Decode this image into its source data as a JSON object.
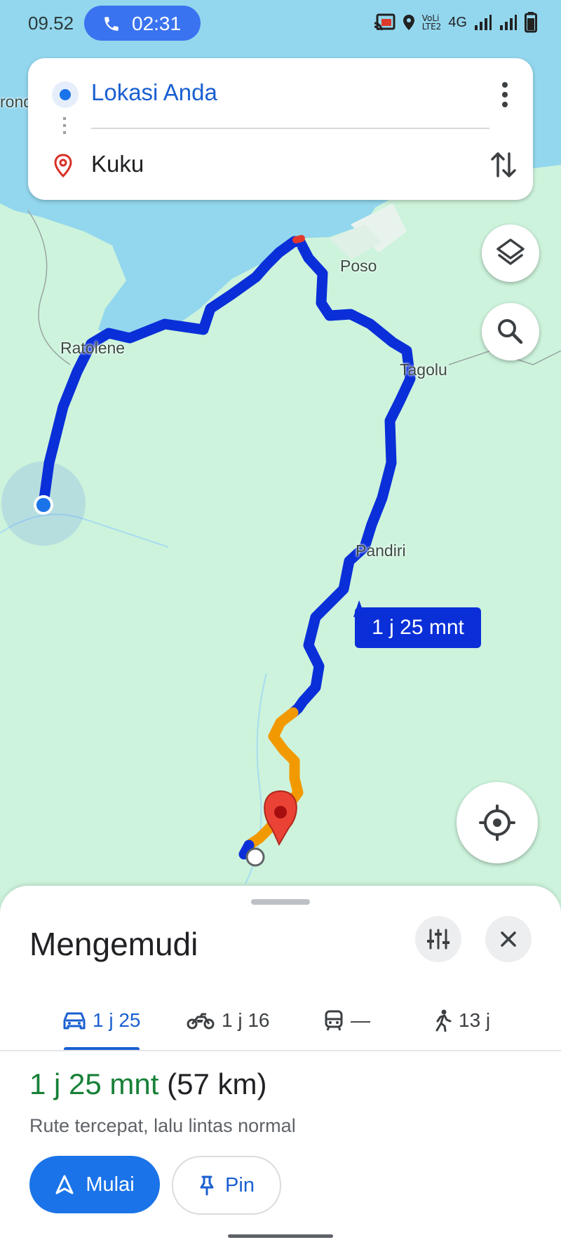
{
  "status_bar": {
    "time": "09.52",
    "call_timer": "02:31",
    "volte_top": "VoLi",
    "volte_bottom": "LTE2",
    "network": "4G"
  },
  "route_card": {
    "origin": "Lokasi Anda",
    "destination": "Kuku"
  },
  "map": {
    "labels": {
      "edge": "rond",
      "ratolene": "Ratolene",
      "poso": "Poso",
      "tagolu": "Tagolu",
      "pandiri": "Pandiri"
    },
    "eta_bubble": "1 j 25 mnt"
  },
  "sheet": {
    "title": "Mengemudi",
    "tabs": [
      {
        "icon": "car-icon",
        "label": "1 j 25"
      },
      {
        "icon": "motorcycle-icon",
        "label": "1 j 16"
      },
      {
        "icon": "train-icon",
        "label": "—"
      },
      {
        "icon": "walk-icon",
        "label": "13 j"
      }
    ],
    "duration": "1 j 25 mnt",
    "distance": "(57 km)",
    "subtitle": "Rute tercepat, lalu lintas normal",
    "start_label": "Mulai",
    "pin_label": "Pin"
  },
  "colors": {
    "accent": "#1a73e8",
    "route": "#0a2fd8",
    "traffic": "#f29900",
    "duration_green": "#188038"
  }
}
